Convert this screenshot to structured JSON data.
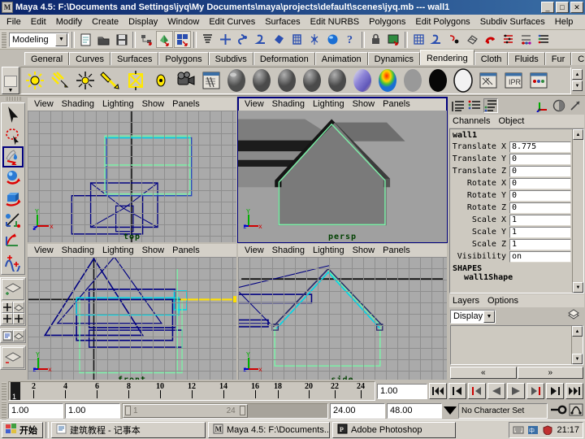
{
  "window": {
    "title": "Maya 4.5: F:\\Documents and Settings\\jyq\\My Documents\\maya\\projects\\default\\scenes\\jyq.mb  ---  wall1",
    "icon": "maya-icon",
    "minimize_label": "_",
    "maximize_label": "□",
    "close_label": "✕"
  },
  "menubar": {
    "items": [
      "File",
      "Edit",
      "Modify",
      "Create",
      "Display",
      "Window",
      "Edit Curves",
      "Surfaces",
      "Edit NURBS",
      "Polygons",
      "Edit Polygons",
      "Subdiv Surfaces",
      "Help"
    ]
  },
  "statusline": {
    "menu_set": "Modeling",
    "dropdown_arrow": "▼",
    "icons": [
      "new-scene-icon",
      "open-scene-icon",
      "save-scene-icon",
      "select-by-hierarchy-icon",
      "select-by-object-icon",
      "select-by-component-icon",
      "mask-hierarchy-icon",
      "plus-icon",
      "select-handle-icon",
      "select-curve-icon",
      "select-surface-icon",
      "select-deformation-icon",
      "select-dynamics-icon",
      "select-rendering-icon",
      "help-icon",
      "lock-icon",
      "snapshot-icon",
      "snap-grid-icon",
      "snap-curve-icon",
      "snap-point-icon",
      "snap-view-icon",
      "magnet-icon",
      "attribute-editor-icon",
      "tool-settings-icon",
      "channel-box-icon"
    ]
  },
  "shelf": {
    "tabs": [
      "General",
      "Curves",
      "Surfaces",
      "Polygons",
      "Subdivs",
      "Deformation",
      "Animation",
      "Dynamics",
      "Rendering",
      "Cloth",
      "Fluids",
      "Fur",
      "Custom"
    ],
    "active_tab": "Rendering",
    "trash_icon": "trash-icon",
    "items": [
      {
        "name": "ambient-light-icon",
        "type": "light-yellow"
      },
      {
        "name": "directional-light-icon",
        "type": "light-yellow"
      },
      {
        "name": "point-light-icon",
        "type": "light-yellow"
      },
      {
        "name": "spot-light-icon",
        "type": "light-yellow"
      },
      {
        "name": "area-light-icon",
        "type": "light-yellow"
      },
      {
        "name": "volume-light-icon",
        "type": "light-small"
      },
      {
        "name": "camera-icon",
        "type": "camera"
      },
      {
        "name": "render-globals-icon",
        "type": "window"
      },
      {
        "name": "lambert-material-icon",
        "type": "sphere-gray"
      },
      {
        "name": "blinn-material-icon",
        "type": "sphere-gray"
      },
      {
        "name": "phong-material-icon",
        "type": "sphere-gray"
      },
      {
        "name": "phonge-material-icon",
        "type": "sphere-gray"
      },
      {
        "name": "anisotropic-material-icon",
        "type": "sphere-gray"
      },
      {
        "name": "layered-shader-icon",
        "type": "sphere-rainbow"
      },
      {
        "name": "ramp-shader-icon",
        "type": "sphere-ramp"
      },
      {
        "name": "surface-shader-icon",
        "type": "sphere-gray"
      },
      {
        "name": "use-background-icon",
        "type": "sphere-black"
      },
      {
        "name": "shading-map-icon",
        "type": "sphere-white"
      },
      {
        "name": "render-view-icon",
        "type": "window"
      },
      {
        "name": "ipr-render-icon",
        "type": "window"
      },
      {
        "name": "batch-render-icon",
        "type": "window"
      }
    ],
    "scroll_up": "▲",
    "scroll_down": "▼"
  },
  "toolbox": {
    "tools": [
      {
        "name": "select-tool",
        "label": "Select Tool",
        "active": false
      },
      {
        "name": "lasso-tool",
        "label": "Lasso Tool",
        "active": false
      },
      {
        "name": "paint-selection-tool",
        "label": "Paint Selection Tool",
        "active": true
      },
      {
        "name": "move-tool",
        "label": "Move Tool",
        "active": false
      },
      {
        "name": "rotate-tool",
        "label": "Rotate Tool",
        "active": false
      },
      {
        "name": "scale-tool",
        "label": "Scale Tool",
        "active": false
      },
      {
        "name": "universal-manipulator-tool",
        "label": "Show Manipulator Tool",
        "active": false
      },
      {
        "name": "soft-modification-tool",
        "label": "Soft Modification Tool",
        "active": false
      }
    ],
    "layouts": [
      {
        "name": "layout-single-perspective"
      },
      {
        "name": "layout-four-view"
      },
      {
        "name": "layout-two-pane-stacked"
      },
      {
        "name": "layout-outliner-persp"
      },
      {
        "name": "layout-hypergraph-persp"
      },
      {
        "name": "layout-single-persp-alt"
      }
    ]
  },
  "viewports": {
    "menu_items": [
      "View",
      "Shading",
      "Lighting",
      "Show",
      "Panels"
    ],
    "panels": [
      {
        "id": "top",
        "label": "top",
        "mode": "wireframe",
        "focused": false
      },
      {
        "id": "persp",
        "label": "persp",
        "mode": "shaded",
        "focused": true
      },
      {
        "id": "front",
        "label": "front",
        "mode": "wireframe",
        "focused": false
      },
      {
        "id": "side",
        "label": "side",
        "mode": "wireframe",
        "focused": false
      }
    ],
    "axis_labels": {
      "x": "x",
      "y": "Y",
      "z": "z"
    },
    "colors": {
      "grid_bg": "#aaaaaa",
      "grid_line": "#8e8e8e",
      "wire_blue": "#000080",
      "wire_cyan": "#00d8e8",
      "select_green": "#7cf0a8",
      "manip_yellow": "#ffe000",
      "shaded_object": "#7a7a7a",
      "label_green": "#004000"
    }
  },
  "channelbox": {
    "icons_left": [
      "channel-box-list-icon",
      "layer-list-icon",
      "channel-layer-icon"
    ],
    "icons_right": [
      "axis-display-icon",
      "attribute-editor-icon",
      "tool-settings-icon"
    ],
    "menu": [
      "Channels",
      "Object"
    ],
    "object_name": "wall1",
    "attributes": [
      {
        "label": "Translate X",
        "value": "8.775"
      },
      {
        "label": "Translate Y",
        "value": "0"
      },
      {
        "label": "Translate Z",
        "value": "0"
      },
      {
        "label": "Rotate X",
        "value": "0"
      },
      {
        "label": "Rotate Y",
        "value": "0"
      },
      {
        "label": "Rotate Z",
        "value": "0"
      },
      {
        "label": "Scale X",
        "value": "1"
      },
      {
        "label": "Scale Y",
        "value": "1"
      },
      {
        "label": "Scale Z",
        "value": "1"
      },
      {
        "label": "Visibility",
        "value": "on"
      }
    ],
    "shapes_header": "SHAPES",
    "shape_name": "wall1Shape",
    "scroll_up": "▲",
    "scroll_down": "▼"
  },
  "layers": {
    "menu": [
      "Layers",
      "Options"
    ],
    "mode": "Display",
    "dropdown_arrow": "▼",
    "new_layer_icon": "new-layer-icon",
    "prev_label": "«",
    "next_label": "»",
    "scroll_up": "▲",
    "scroll_down": "▼",
    "items": []
  },
  "timeslider": {
    "current_frame": "1",
    "current_frame_field": "1.00",
    "ticks": [
      "2",
      "4",
      "6",
      "8",
      "10",
      "12",
      "14",
      "16",
      "18",
      "20",
      "22",
      "24"
    ],
    "playback_buttons": [
      {
        "name": "go-to-start-button",
        "glyph": "❙◀◀"
      },
      {
        "name": "step-back-key-button",
        "glyph": "❙◀"
      },
      {
        "name": "step-back-frame-button",
        "glyph": "❙◀"
      },
      {
        "name": "play-backwards-button",
        "glyph": "◀"
      },
      {
        "name": "play-forwards-button",
        "glyph": "▶"
      },
      {
        "name": "step-forward-frame-button",
        "glyph": "▶❙"
      },
      {
        "name": "step-forward-key-button",
        "glyph": "▶❙"
      },
      {
        "name": "go-to-end-button",
        "glyph": "▶▶❙"
      }
    ]
  },
  "rangeslider": {
    "anim_start": "1.00",
    "range_start": "1.00",
    "bar_start_label": "1",
    "bar_end_label": "24",
    "range_end": "24.00",
    "anim_end": "48.00",
    "dropdown_arrow": "▼",
    "character_set": "No Character Set",
    "auto_key_icon": "auto-keyframe-icon",
    "anim_prefs_icon": "animation-preferences-icon"
  },
  "taskbar": {
    "start_label": "开始",
    "start_icon": "windows-start-icon",
    "items": [
      {
        "label": "建筑教程 - 记事本",
        "icon": "notepad-icon"
      },
      {
        "label": "Maya 4.5: F:\\Documents...",
        "icon": "maya-icon"
      },
      {
        "label": "Adobe Photoshop",
        "icon": "photoshop-icon"
      }
    ],
    "tray_icons": [
      "keyboard-icon",
      "input-method-icon",
      "antivirus-icon"
    ],
    "clock": "21:17"
  }
}
